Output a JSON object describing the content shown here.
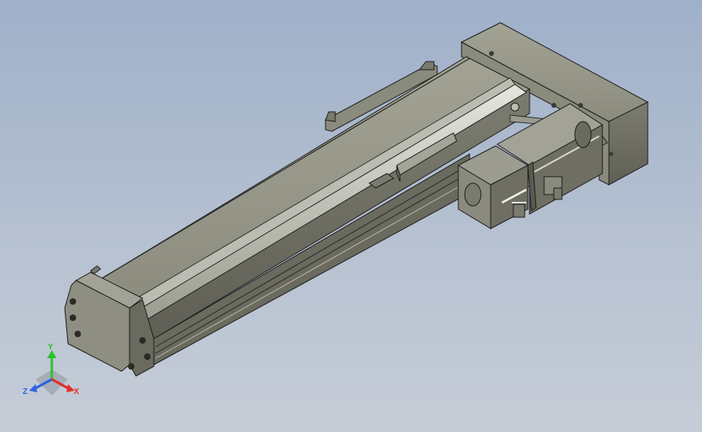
{
  "viewport": {
    "background_top": "#9fb0c9",
    "background_bottom": "#c6cdd7"
  },
  "model": {
    "body_color": "#8e8e80",
    "edge_color": "#1e1e1e",
    "highlight_color": "#d8d8d0"
  },
  "triad": {
    "x_label": "X",
    "y_label": "Y",
    "z_label": "Z",
    "x_color": "#e0302a",
    "y_color": "#2ec22e",
    "z_color": "#3060e0"
  }
}
